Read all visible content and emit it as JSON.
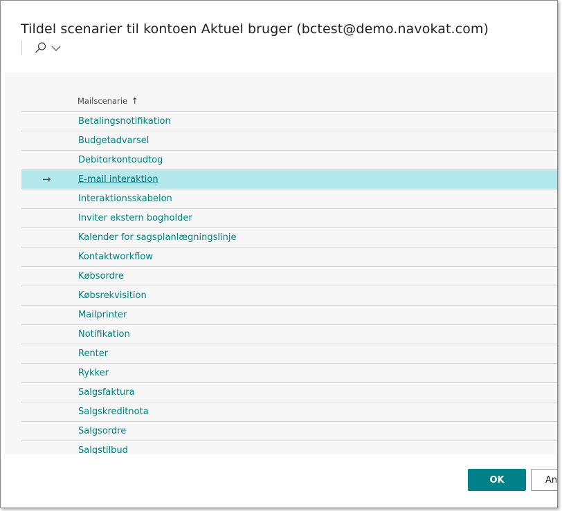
{
  "dialog": {
    "title": "Tildel scenarier til kontoen Aktuel bruger (bctest@demo.navokat.com)"
  },
  "toolbar": {
    "search_icon": "search-icon",
    "chevron_icon": "chevron-down-icon"
  },
  "table": {
    "column_header": "Mailscenarie",
    "sort_indicator": "↑",
    "selected_marker": "→",
    "more_menu": "⋮",
    "rows": [
      "Betalingsnotifikation",
      "Budgetadvarsel",
      "Debitorkontoudtog",
      "E-mail interaktion",
      "Interaktionsskabelon",
      "Inviter ekstern bogholder",
      "Kalender for sagsplanlægningslinje",
      "Kontaktworkflow",
      "Købsordre",
      "Købsrekvisition",
      "Mailprinter",
      "Notifikation",
      "Renter",
      "Rykker",
      "Salgsfaktura",
      "Salgskreditnota",
      "Salgsordre",
      "Salgstilbud"
    ],
    "selected_index": 3
  },
  "footer": {
    "ok_label": "OK",
    "cancel_label": "Annuller"
  },
  "colors": {
    "accent": "#00818a",
    "link": "#007e7e",
    "selected_row": "#b3e9ec"
  }
}
